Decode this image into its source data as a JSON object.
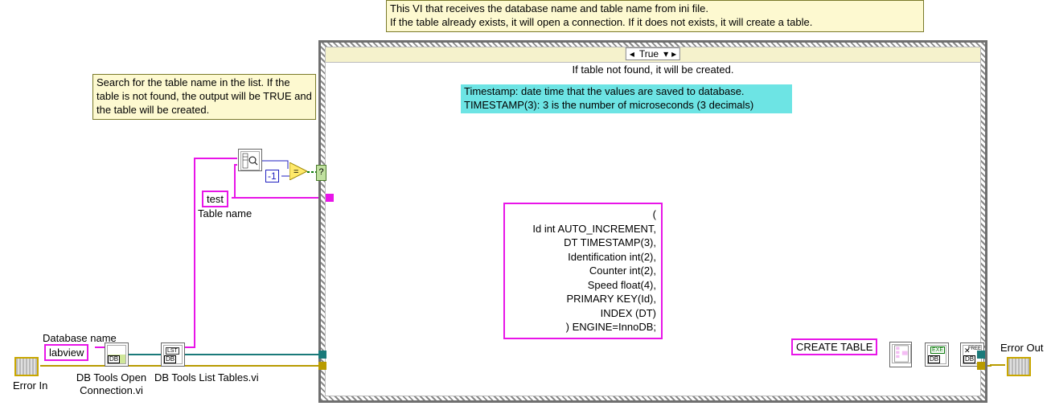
{
  "top_comment": "This VI that receives the database name and table name from ini file.\nIf the table already exists, it will open a connection. If it does not exists, it will create a table.",
  "search_comment": "Search for the table name in the list. If the table is not found, the output will be TRUE and the table will be created.",
  "case_selector": "True",
  "case_subtitle": "If table not found, it will be created.",
  "timestamp_comment": "Timestamp: date time that the values are saved to database.\nTIMESTAMP(3): 3 is the number of microseconds (3 decimals)",
  "table_name_label": "Table name",
  "table_name_value": "test",
  "database_name_label": "Database name",
  "database_name_value": "labview",
  "neg1": "-1",
  "sql_block": "(\nId int AUTO_INCREMENT,\nDT TIMESTAMP(3),\nIdentification int(2),\nCounter int(2),\nSpeed float(4),\nPRIMARY KEY(Id),\nINDEX (DT)\n) ENGINE=InnoDB;",
  "create_table": "CREATE TABLE",
  "error_in": "Error In",
  "error_out": "Error Out",
  "vi_open_conn": "DB Tools Open Connection.vi",
  "vi_list_tables": "DB Tools List Tables.vi"
}
